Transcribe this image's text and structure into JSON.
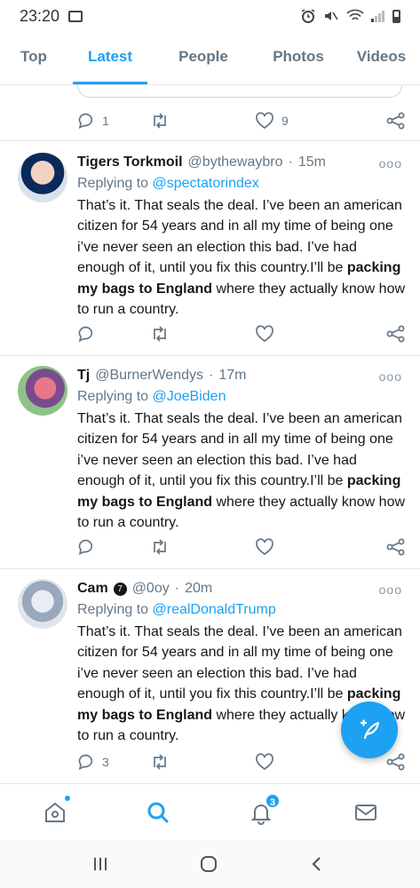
{
  "status_bar": {
    "time": "23:20"
  },
  "tabs": [
    {
      "label": "Top",
      "active": false
    },
    {
      "label": "Latest",
      "active": true
    },
    {
      "label": "People",
      "active": false
    },
    {
      "label": "Photos",
      "active": false
    },
    {
      "label": "Videos",
      "active": false
    }
  ],
  "first_actions": {
    "reply_count": "1",
    "like_count": "9"
  },
  "tweets": [
    {
      "name": "Tigers Torkmoil",
      "handle": "@bythewaybro",
      "time": "15m",
      "replying_prefix": "Replying to",
      "replying_to": "@spectatorindex",
      "body_pre": "That’s it. That seals the deal. I’ve been an american citizen for 54 years and in all my time of being one i’ve never seen an election this bad. I’ve had enough of it, until you fix this country.I’ll be ",
      "body_bold": "packing my bags to England",
      "body_post": " where they actually know how to run a country.",
      "reply_count": "",
      "like_count": ""
    },
    {
      "name": "Tj",
      "handle": "@BurnerWendys",
      "time": "17m",
      "replying_prefix": "Replying to",
      "replying_to": "@JoeBiden",
      "body_pre": "That’s it. That seals the deal. I’ve been an american citizen for 54 years and in all my time of being one i’ve never seen an election this bad. I’ve had enough of it, until you fix this country.I’ll be ",
      "body_bold": "packing my bags to England",
      "body_post": " where they actually know how to run a country.",
      "reply_count": "",
      "like_count": ""
    },
    {
      "name": "Cam",
      "verified_glyph": "7",
      "handle": "@0oy",
      "time": "20m",
      "replying_prefix": "Replying to",
      "replying_to": "@realDonaldTrump",
      "body_pre": "That’s it. That seals the deal. I’ve been an american citizen for 54 years and in all my time of being one i’ve never seen an election this bad. I’ve had enough of it, until you fix this country.I’ll be ",
      "body_bold": "packing my bags to England",
      "body_post": " where they actually know how to run a country.",
      "reply_count": "3",
      "like_count": ""
    }
  ],
  "time_separator": "·",
  "more_glyph": "ooo",
  "bottom_nav": {
    "notifications_badge": "3"
  },
  "colors": {
    "accent": "#1da1f2",
    "muted": "#657786",
    "text": "#14171a",
    "divider": "#e1e8ed"
  }
}
